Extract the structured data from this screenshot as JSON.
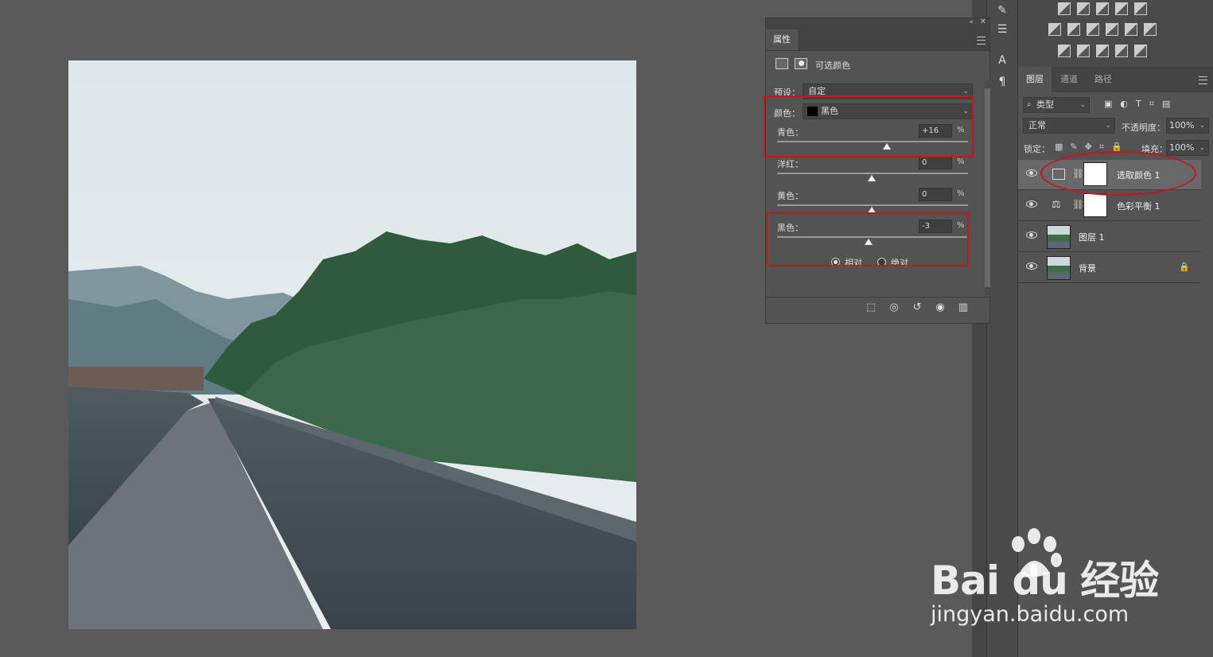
{
  "properties_panel": {
    "tab_label": "属性",
    "adjustment_title": "可选颜色",
    "preset_label": "预设：",
    "preset_value": "自定",
    "colors_label": "颜色：",
    "colors_value": "黑色",
    "sliders": [
      {
        "label": "青色：",
        "value": "+16",
        "unit": "%"
      },
      {
        "label": "洋红：",
        "value": "0",
        "unit": "%"
      },
      {
        "label": "黄色：",
        "value": "0",
        "unit": "%"
      },
      {
        "label": "黑色：",
        "value": "-3",
        "unit": "%"
      }
    ],
    "method_relative": "相对",
    "method_absolute": "绝对",
    "selected_method": "relative"
  },
  "layers_panel": {
    "tabs": [
      "图层",
      "通道",
      "路径"
    ],
    "active_tab": "图层",
    "filter_label": "类型",
    "blend_mode": "正常",
    "opacity_label": "不透明度：",
    "opacity_value": "100%",
    "lock_label": "锁定：",
    "fill_label": "填充：",
    "fill_value": "100%",
    "layers": [
      {
        "name": "选取颜色 1",
        "type": "adjustment-selective-color",
        "visible": true,
        "selected": true
      },
      {
        "name": "色彩平衡 1",
        "type": "adjustment-color-balance",
        "visible": true,
        "selected": false
      },
      {
        "name": "图层 1",
        "type": "pixel",
        "visible": true,
        "selected": false
      },
      {
        "name": "背景",
        "type": "background",
        "visible": true,
        "selected": false,
        "locked": true
      }
    ]
  },
  "watermark": {
    "brand": "Bai du 经验",
    "url": "jingyan.baidu.com"
  },
  "colors": {
    "workspace": "#595959",
    "panel": "#535353",
    "highlight_red": "#c8161d"
  }
}
